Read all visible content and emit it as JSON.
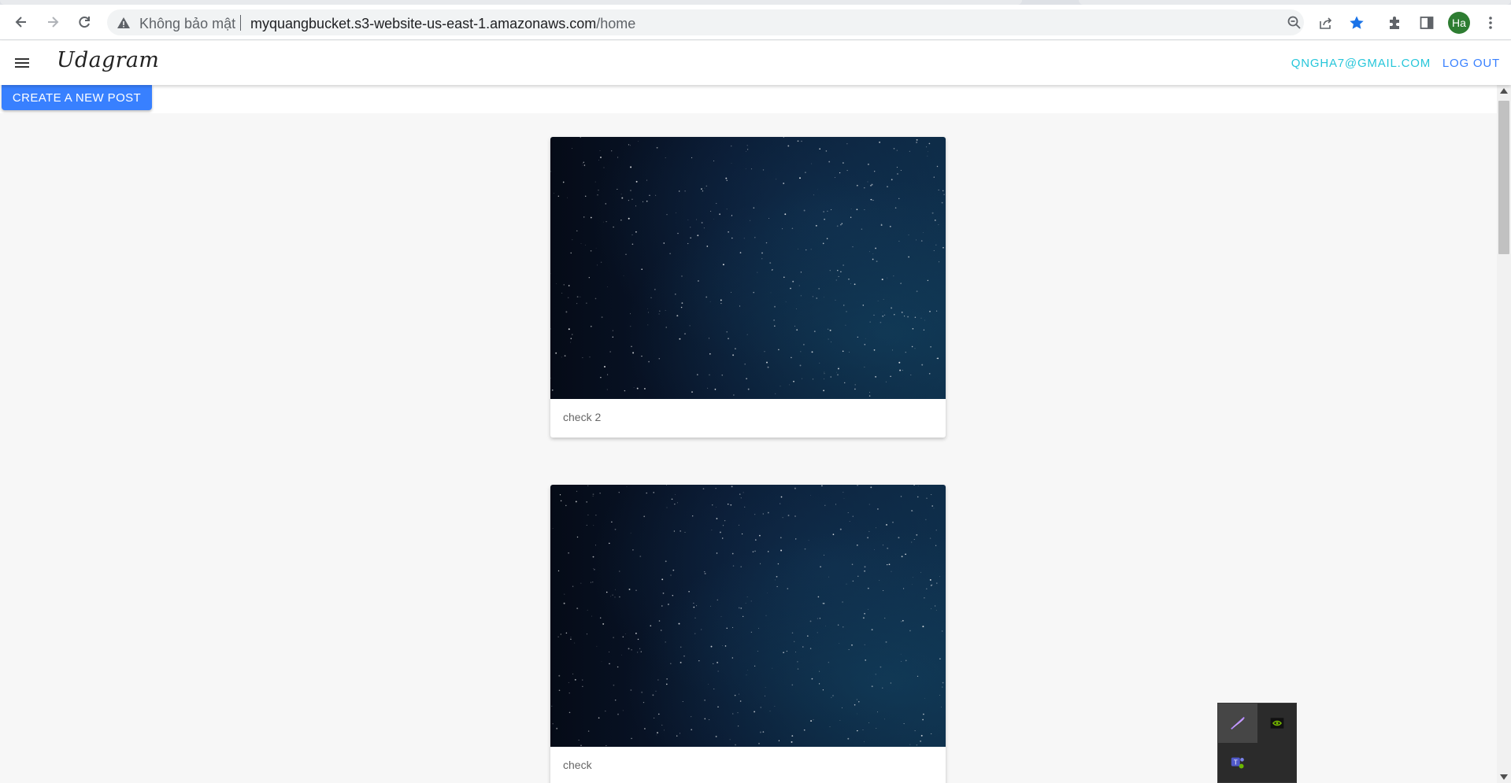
{
  "browser": {
    "security_label": "Không bảo mật",
    "url_host": "myquangbucket.s3-website-us-east-1.amazonaws.com",
    "url_path": "/home",
    "profile_initials": "Ha"
  },
  "app": {
    "brand": "Udagram",
    "user_email": "QNGHA7@GMAIL.COM",
    "logout_label": "LOG OUT",
    "create_post_label": "CREATE A NEW POST"
  },
  "posts": [
    {
      "caption": "check 2"
    },
    {
      "caption": "check"
    }
  ],
  "colors": {
    "accent_blue": "#3880ff",
    "accent_cyan": "#26c6da"
  },
  "tray_icons": [
    "feather-icon",
    "nvidia-icon",
    "teams-icon"
  ]
}
